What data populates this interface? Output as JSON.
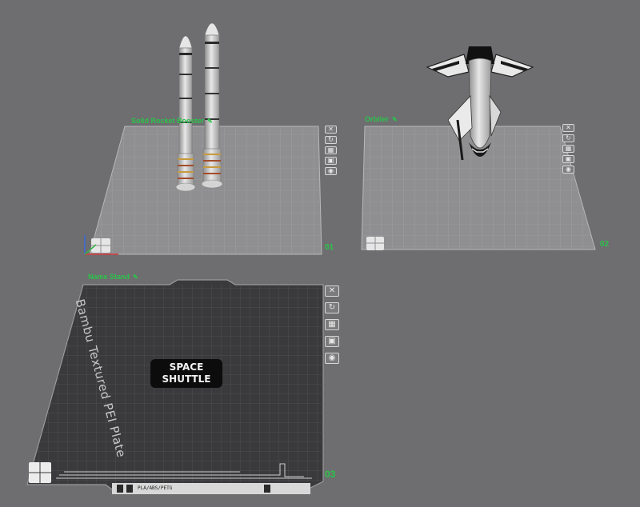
{
  "plates": [
    {
      "name": "Solid Rocket Booster",
      "number": "01"
    },
    {
      "name": "Orbiter",
      "number": "02"
    },
    {
      "name": "Name Stand",
      "number": "03",
      "bed_label": "Bambu Textured PEI Plate",
      "tag_text": "PLA/ABS/PETG"
    }
  ],
  "model_text": {
    "line1": "SPACE",
    "line2": "SHUTTLE"
  },
  "plate_toolbar_icons": [
    "close-icon",
    "rotate-icon",
    "arrange-icon",
    "lock-icon",
    "eye-icon"
  ],
  "colors": {
    "accent_green": "#2cc24b",
    "background": "#6e6e70",
    "bed_dark": "#3a3a3c"
  }
}
